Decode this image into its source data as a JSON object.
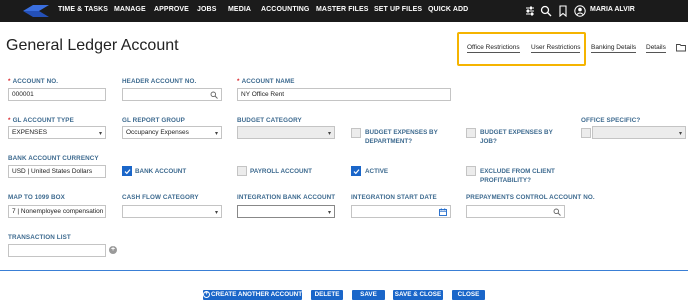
{
  "nav": {
    "items": [
      "TIME & TASKS",
      "MANAGE",
      "APPROVE",
      "JOBS",
      "MEDIA",
      "ACCOUNTING",
      "MASTER FILES",
      "SET UP FILES",
      "QUICK ADD"
    ],
    "user_name": "MARIA ALVIR",
    "icons": [
      "sliders-icon",
      "search-icon",
      "bookmark-icon",
      "user-avatar-icon"
    ]
  },
  "header": {
    "title": "General Ledger Account",
    "links": [
      "Office Restrictions",
      "User Restrictions",
      "Banking Details",
      "Details"
    ],
    "highlight_color": "#f5b400"
  },
  "form": {
    "account_no": {
      "label": "ACCOUNT NO.",
      "value": "000001"
    },
    "header_account_no": {
      "label": "HEADER ACCOUNT NO.",
      "value": ""
    },
    "account_name": {
      "label": "ACCOUNT NAME",
      "value": "NY Office Rent"
    },
    "gl_account_type": {
      "label": "GL ACCOUNT TYPE",
      "value": "EXPENSES"
    },
    "gl_report_group": {
      "label": "GL REPORT GROUP",
      "value": "Occupancy Expenses"
    },
    "budget_category": {
      "label": "BUDGET CATEGORY",
      "value": ""
    },
    "budget_by_department": {
      "label_line1": "BUDGET EXPENSES BY",
      "label_line2": "DEPARTMENT?",
      "checked": false
    },
    "budget_by_job": {
      "label_line1": "BUDGET EXPENSES BY",
      "label_line2": "JOB?",
      "checked": false
    },
    "office_specific": {
      "label": "OFFICE SPECIFIC?",
      "checked": false,
      "value": ""
    },
    "bank_account_currency": {
      "label": "BANK ACCOUNT CURRENCY",
      "value": "USD | United States Dollars"
    },
    "bank_account": {
      "label": "BANK ACCOUNT",
      "checked": true
    },
    "payroll_account": {
      "label": "PAYROLL ACCOUNT",
      "checked": false
    },
    "active": {
      "label": "ACTIVE",
      "checked": true
    },
    "exclude_profitability": {
      "label_line1": "EXCLUDE FROM CLIENT",
      "label_line2": "PROFITABILITY?",
      "checked": false
    },
    "map_to_1099": {
      "label": "MAP TO 1099 BOX",
      "value": "7 | Nonemployee compensation"
    },
    "cash_flow_category": {
      "label": "CASH FLOW CATEGORY",
      "value": ""
    },
    "integration_bank_account": {
      "label": "INTEGRATION BANK ACCOUNT",
      "value": ""
    },
    "integration_start_date": {
      "label": "INTEGRATION START DATE",
      "value": ""
    },
    "prepayments_control": {
      "label": "PREPAYMENTS CONTROL ACCOUNT NO.",
      "value": ""
    },
    "transaction_list": {
      "label": "TRANSACTION LIST",
      "value": ""
    }
  },
  "footer": {
    "buttons": [
      "CREATE ANOTHER ACCOUNT",
      "DELETE",
      "SAVE",
      "SAVE & CLOSE",
      "CLOSE"
    ],
    "accent": "#1a66c9"
  }
}
